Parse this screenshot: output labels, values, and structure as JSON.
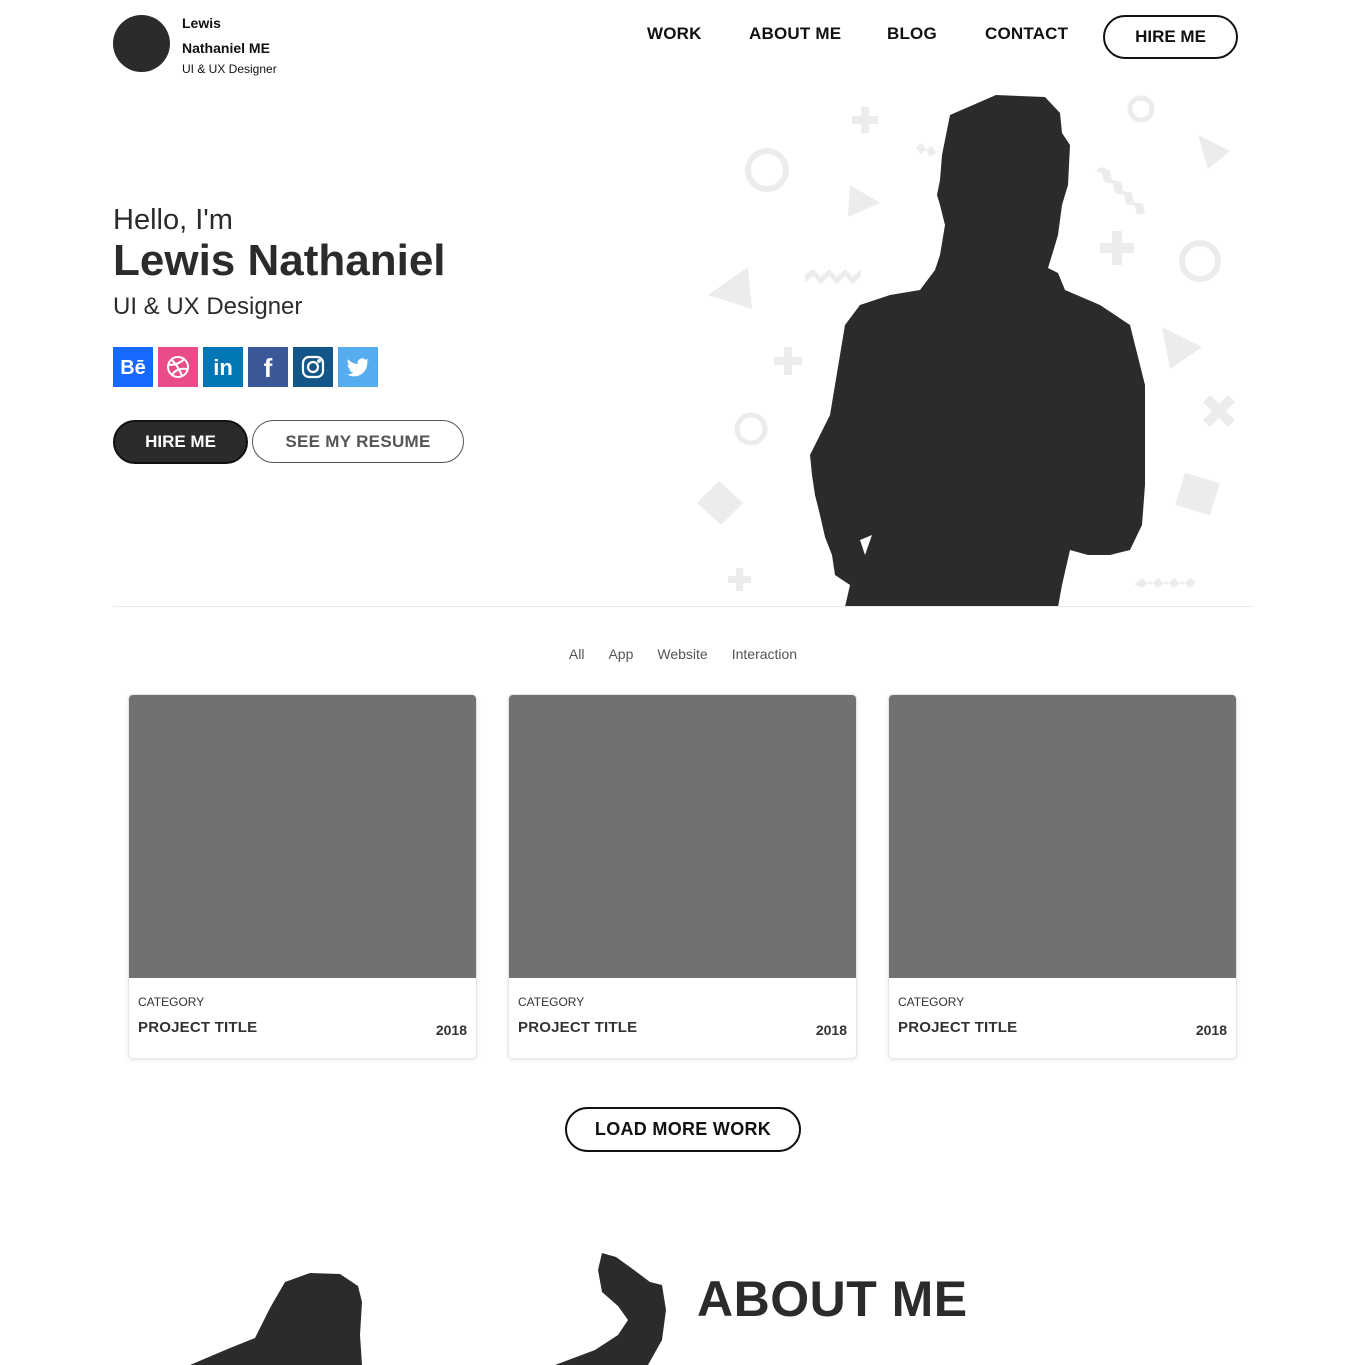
{
  "header": {
    "logo": {
      "name": "Lewis Nathaniel ME",
      "role": "UI & UX Designer"
    },
    "nav": [
      "WORK",
      "ABOUT ME",
      "BLOG",
      "CONTACT"
    ],
    "hire_label": "HIRE ME"
  },
  "hero": {
    "greeting": "Hello, I'm",
    "name": "Lewis Nathaniel",
    "role": "UI & UX Designer",
    "socials": [
      {
        "icon": "behance-icon",
        "color": "#1769ff"
      },
      {
        "icon": "dribbble-icon",
        "color": "#ea4c89"
      },
      {
        "icon": "linkedin-icon",
        "color": "#0077b5"
      },
      {
        "icon": "facebook-icon",
        "color": "#3b5998"
      },
      {
        "icon": "instagram-icon",
        "color": "#125688"
      },
      {
        "icon": "twitter-icon",
        "color": "#55acee"
      }
    ],
    "hire_label": "HIRE ME",
    "resume_label": "SEE MY RESUME"
  },
  "work": {
    "filters": [
      "All",
      "App",
      "Website",
      "Interaction"
    ],
    "cards": [
      {
        "category": "CATEGORY",
        "title": "PROJECT TITLE",
        "year": "2018"
      },
      {
        "category": "CATEGORY",
        "title": "PROJECT TITLE",
        "year": "2018"
      },
      {
        "category": "CATEGORY",
        "title": "PROJECT TITLE",
        "year": "2018"
      }
    ],
    "load_more_label": "LOAD MORE WORK"
  },
  "about": {
    "title": "ABOUT ME"
  }
}
